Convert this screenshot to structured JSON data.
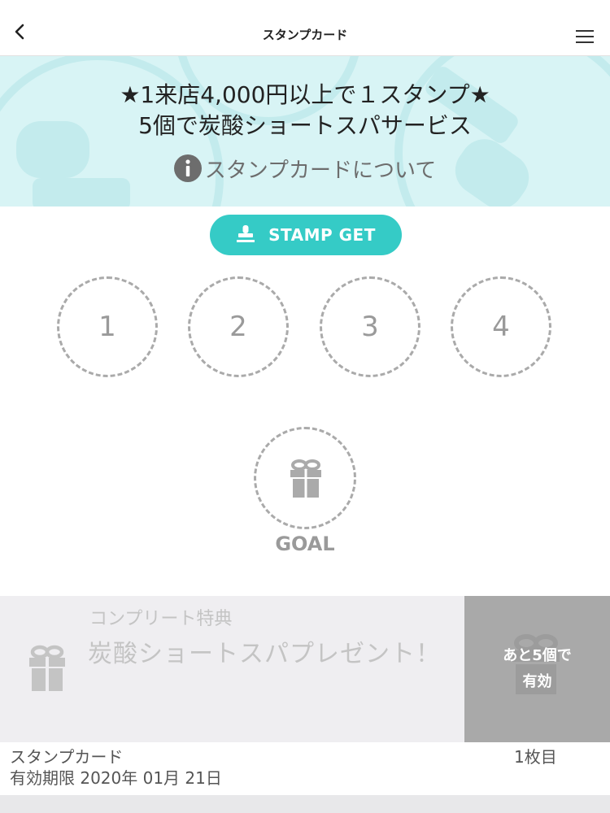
{
  "header": {
    "title": "スタンプカード",
    "back_icon": "chevron-left-icon",
    "menu_icon": "hamburger-menu-icon"
  },
  "banner": {
    "line1": "★1来店4,000円以上で１スタンプ★",
    "line2": "5個で炭酸ショートスパサービス",
    "about_link": "スタンプカードについて",
    "background_color": "#d8f4f5"
  },
  "stamp_button": {
    "label": "STAMP GET",
    "icon": "stamp-icon",
    "color": "#35cbc6"
  },
  "slots": [
    "1",
    "2",
    "3",
    "4"
  ],
  "goal": {
    "label": "GOAL",
    "icon": "gift-icon"
  },
  "reward": {
    "subtitle": "コンプリート特典",
    "name": "炭酸ショートスパプレゼント！",
    "remaining_line1": "あと5個で",
    "remaining_line2": "有効"
  },
  "footer": {
    "card_label": "スタンプカード",
    "expiry": "有効期限 2020年 01月 21日",
    "card_count": "1枚目"
  }
}
